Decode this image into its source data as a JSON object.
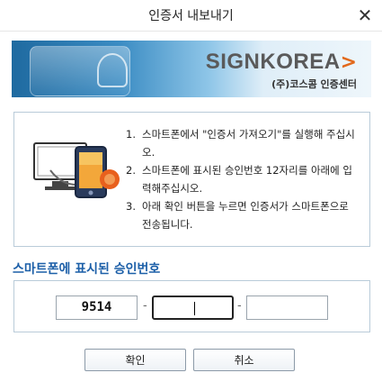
{
  "window": {
    "title": "인증서 내보내기"
  },
  "banner": {
    "brand_name": "SIGNKOREA",
    "brand_arrow": ">",
    "brand_sub": "(주)코스콤 인증센터"
  },
  "instructions": {
    "steps": [
      {
        "num": "1.",
        "text": "스마트폰에서 \"인증서 가져오기\"를 실행해 주십시오."
      },
      {
        "num": "2.",
        "text": "스마트폰에 표시된 승인번호 12자리를 아래에 입력해주십시오."
      },
      {
        "num": "3.",
        "text": "아래 확인 버튼을 누르면 인증서가 스마트폰으로 전송됩니다."
      }
    ]
  },
  "approval": {
    "section_title": "스마트폰에 표시된 승인번호",
    "fields": [
      "9514",
      "",
      ""
    ],
    "separator": "-"
  },
  "buttons": {
    "confirm": "확인",
    "cancel": "취소"
  },
  "colors": {
    "accent": "#1c5fa8",
    "brand_orange": "#e2691c",
    "border": "#b9cbd9"
  }
}
